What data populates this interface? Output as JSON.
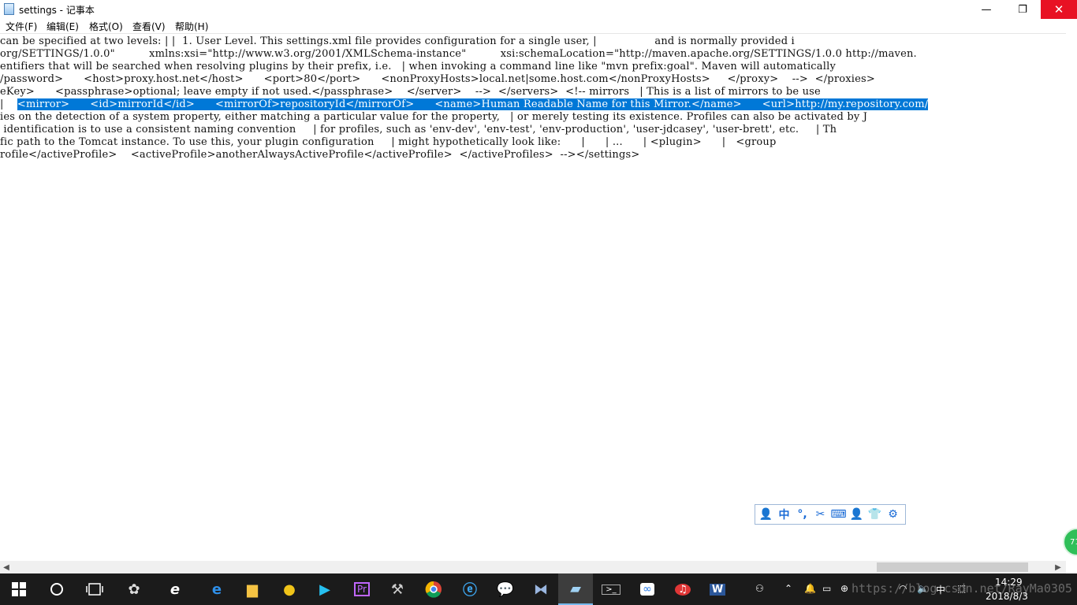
{
  "window": {
    "title": "settings - 记事本",
    "controls": {
      "minimize": "—",
      "maximize": "❐",
      "close": "✕"
    }
  },
  "menu": [
    "文件(F)",
    "编辑(E)",
    "格式(O)",
    "查看(V)",
    "帮助(H)"
  ],
  "editor": {
    "lines": [
      {
        "text": "can be specified at two levels: | |  1. User Level. This settings.xml file provides configuration for a single user, |                 and is normally provided i"
      },
      {
        "text": "org/SETTINGS/1.0.0\"          xmlns:xsi=\"http://www.w3.org/2001/XMLSchema-instance\"          xsi:schemaLocation=\"http://maven.apache.org/SETTINGS/1.0.0 http://maven."
      },
      {
        "text": "entifiers that will be searched when resolving plugins by their prefix, i.e.   | when invoking a command line like \"mvn prefix:goal\". Maven will automatically"
      },
      {
        "text": "/password>      <host>proxy.host.net</host>      <port>80</port>      <nonProxyHosts>local.net|some.host.com</nonProxyHosts>     </proxy>    -->  </proxies>"
      },
      {
        "text": "eKey>      <passphrase>optional; leave empty if not used.</passphrase>    </server>    -->  </servers>  <!-- mirrors   | This is a list of mirrors to be use"
      },
      {
        "pre": "|    ",
        "sel": "<mirror>      <id>mirrorId</id>      <mirrorOf>repositoryId</mirrorOf>      <name>Human Readable Name for this Mirror.</name>      <url>http://my.repository.com/"
      },
      {
        "text": "ies on the detection of a system property, either matching a particular value for the property,   | or merely testing its existence. Profiles can also be activated by J"
      },
      {
        "text": " identification is to use a consistent naming convention     | for profiles, such as 'env-dev', 'env-test', 'env-production', 'user-jdcasey', 'user-brett', etc.     | Th"
      },
      {
        "text": "fic path to the Tomcat instance. To use this, your plugin configuration     | might hypothetically look like:      |      | ...      | <plugin>      |   <group"
      },
      {
        "text": "rofile</activeProfile>    <activeProfile>anotherAlwaysActiveProfile</activeProfile>  </activeProfiles>  --></settings>"
      }
    ]
  },
  "ime_toolbar": [
    "👤",
    "中",
    "°,",
    "✂",
    "⌨",
    "👤",
    "👕",
    "⚙"
  ],
  "float_ball": "71",
  "taskbar": {
    "apps": [
      "start-icon",
      "cortana-icon",
      "task-view-icon",
      "app-icon",
      "ie-icon",
      "edge-icon",
      "explorer-icon",
      "app-icon",
      "app-icon",
      "premiere-icon",
      "tools-icon",
      "chrome-icon",
      "ie-icon",
      "wechat-icon",
      "vs-icon",
      "notepad-icon",
      "cmd-icon",
      "baidu-icon",
      "netease-icon",
      "word-icon"
    ],
    "time": "14:29",
    "date": "2018/8/3",
    "ime": "中"
  },
  "watermark": "https://blog.csdn.net/RayMa0305"
}
